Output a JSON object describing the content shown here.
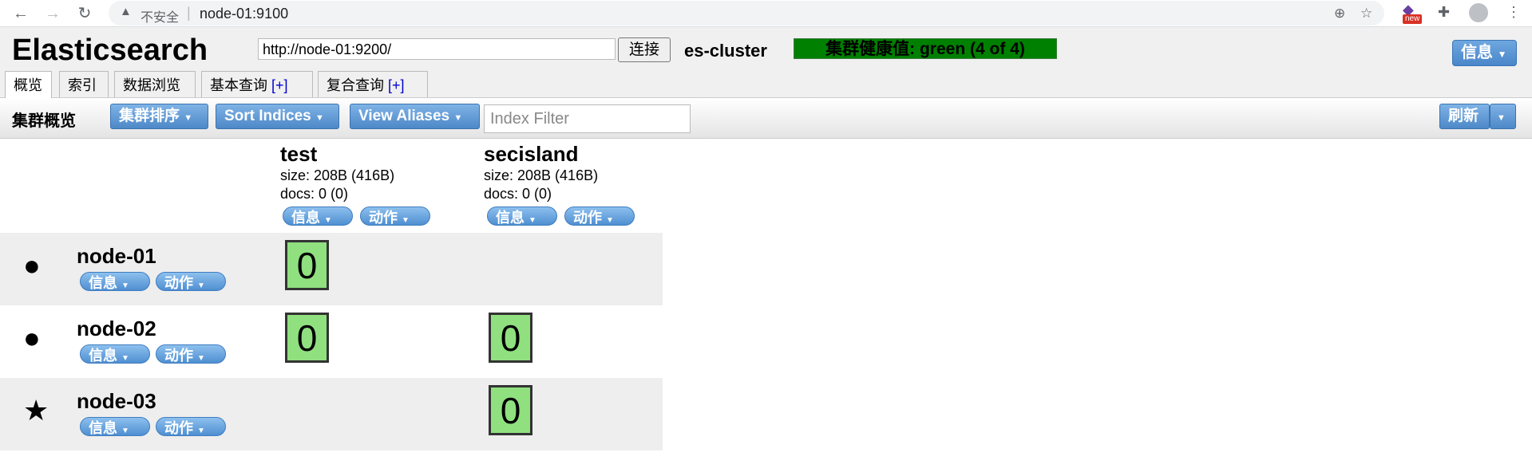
{
  "browser": {
    "insecure_label": "不安全",
    "url": "node-01:9100",
    "new_badge": "new"
  },
  "header": {
    "brand": "Elasticsearch",
    "connect_url": "http://node-01:9200/",
    "connect_button": "连接",
    "cluster_name": "es-cluster",
    "health_text": "集群健康值: green (4 of 4)",
    "health_color": "#008000",
    "info_menu": "信息"
  },
  "tabs": [
    {
      "label": "概览"
    },
    {
      "label": "索引"
    },
    {
      "label": "数据浏览"
    },
    {
      "label": "基本查询",
      "plus": "[+]"
    },
    {
      "label": "复合查询",
      "plus": "[+]"
    }
  ],
  "toolbar": {
    "title": "集群概览",
    "sort_cluster": "集群排序",
    "sort_indices": "Sort Indices",
    "view_aliases": "View Aliases",
    "filter_placeholder": "Index Filter",
    "refresh": "刷新"
  },
  "buttons": {
    "info": "信息",
    "action": "动作"
  },
  "indices": [
    {
      "name": "test",
      "size": "size: 208B (416B)",
      "docs": "docs: 0 (0)"
    },
    {
      "name": "secisland",
      "size": "size: 208B (416B)",
      "docs": "docs: 0 (0)"
    }
  ],
  "nodes": [
    {
      "name": "node-01",
      "icon": "●",
      "shards": {
        "test": "0"
      }
    },
    {
      "name": "node-02",
      "icon": "●",
      "shards": {
        "test": "0",
        "secisland": "0"
      }
    },
    {
      "name": "node-03",
      "icon": "★",
      "shards": {
        "secisland": "0"
      }
    }
  ]
}
